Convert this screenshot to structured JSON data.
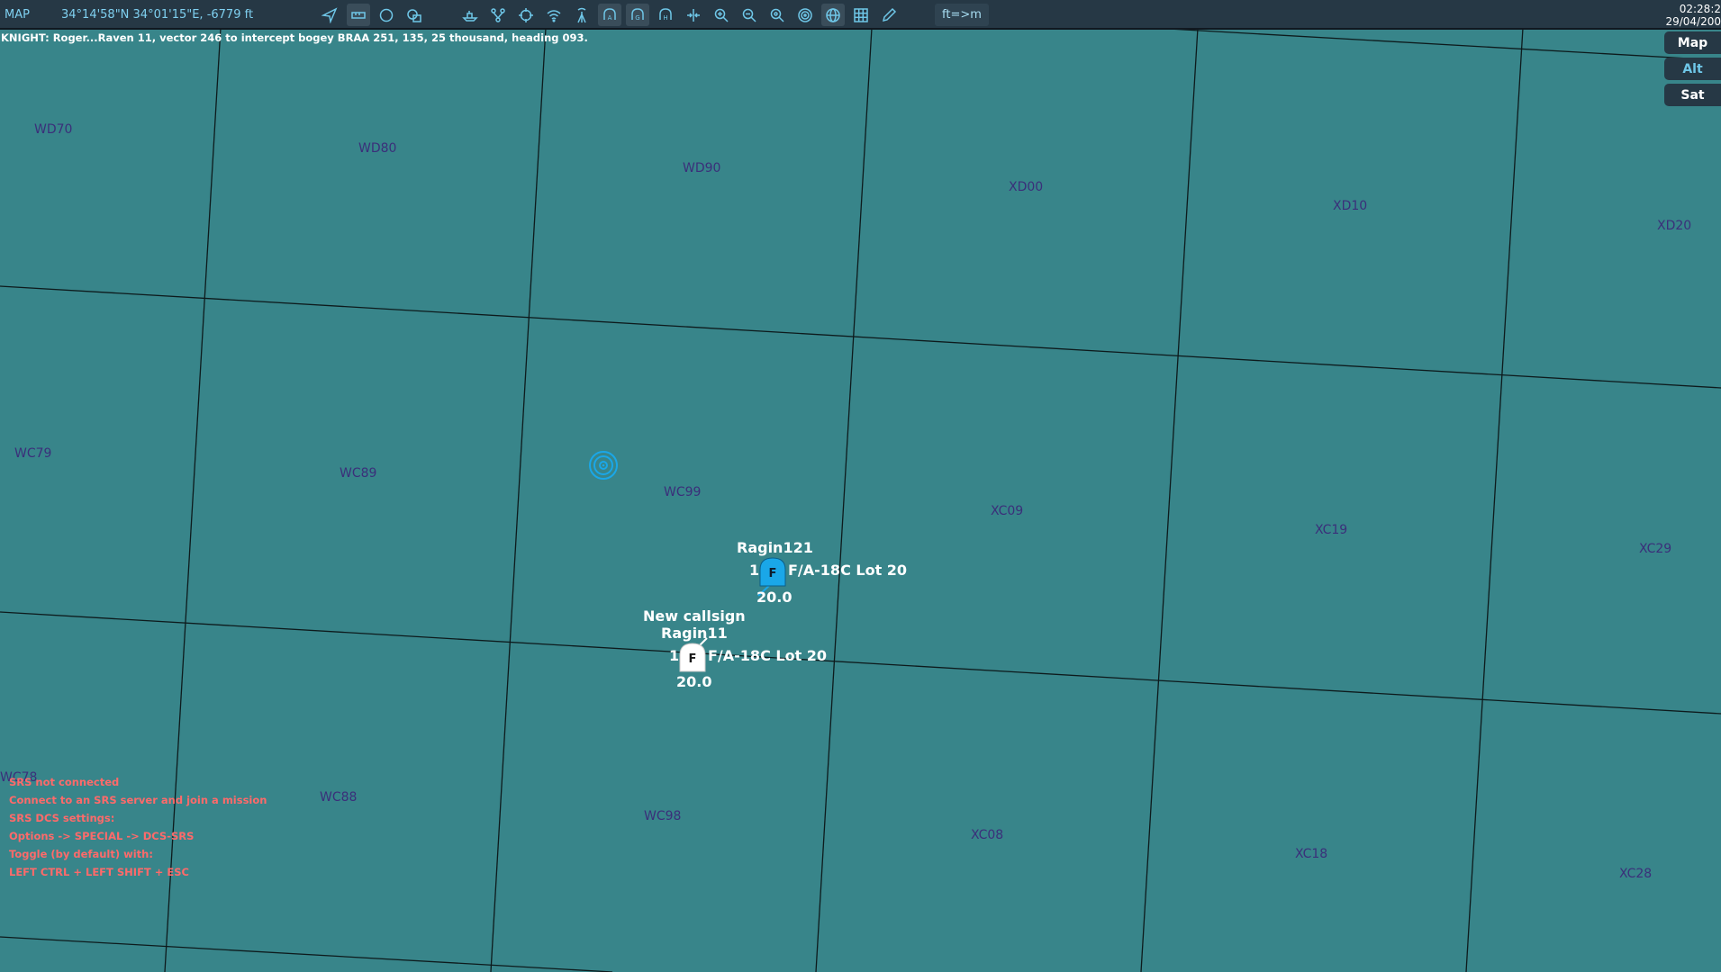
{
  "topbar": {
    "mode_label": "MAP",
    "coordinates": "34°14'58\"N 34°01'15\"E, -6779 ft",
    "units_toggle": "ft=>m",
    "clock_time": "02:28:2",
    "clock_date": "29/04/200",
    "icons": [
      "navigate-icon",
      "ruler-icon",
      "circle-icon",
      "layers-icon",
      "ship-icon",
      "route-icon",
      "crosshair-icon",
      "wifi-icon",
      "antenna-icon",
      "aircraft-a-icon",
      "aircraft-g-icon",
      "aircraft-h-icon",
      "split-icon",
      "zoom-in-icon",
      "zoom-out-icon",
      "zoom-fit-icon",
      "target-icon",
      "globe-icon",
      "grid-icon",
      "pen-icon"
    ]
  },
  "message": "KNIGHT: Roger...Raven 11, vector 246 to intercept bogey BRAA 251, 135, 25 thousand, heading 093.",
  "layers": {
    "map": "Map",
    "alt": "Alt",
    "sat": "Sat"
  },
  "grid_labels": [
    "WD70",
    "WD80",
    "WD90",
    "XD00",
    "XD10",
    "XD20",
    "WC79",
    "WC89",
    "WC99",
    "XC09",
    "XC19",
    "XC29",
    "WC78",
    "WC88",
    "WC98",
    "XC08",
    "XC18",
    "XC28"
  ],
  "units": {
    "ragin121": {
      "callsign": "Ragin121",
      "count": "1",
      "type": "F/A-18C Lot 20",
      "altitude": "20.0",
      "symbol": "F"
    },
    "ragin11": {
      "status": "New callsign",
      "callsign": "Ragin11",
      "count": "1",
      "type": "F/A-18C Lot 20",
      "altitude": "20.0",
      "symbol": "F"
    }
  },
  "srs": {
    "line1": "SRS not connected",
    "line2": "Connect to an SRS server and join a mission",
    "line3": "SRS DCS settings:",
    "line4": "Options -> SPECIAL -> DCS-SRS",
    "line5": "Toggle (by default) with:",
    "line6": "LEFT CTRL + LEFT SHIFT + ESC"
  },
  "colors": {
    "map_bg": "#38858a",
    "toolbar_bg": "#263845",
    "icon": "#6fc7e8",
    "grid_label": "#3b2f7a",
    "friendly_selected": "#1aa7e8",
    "srs_warning": "#ff6a6a"
  }
}
